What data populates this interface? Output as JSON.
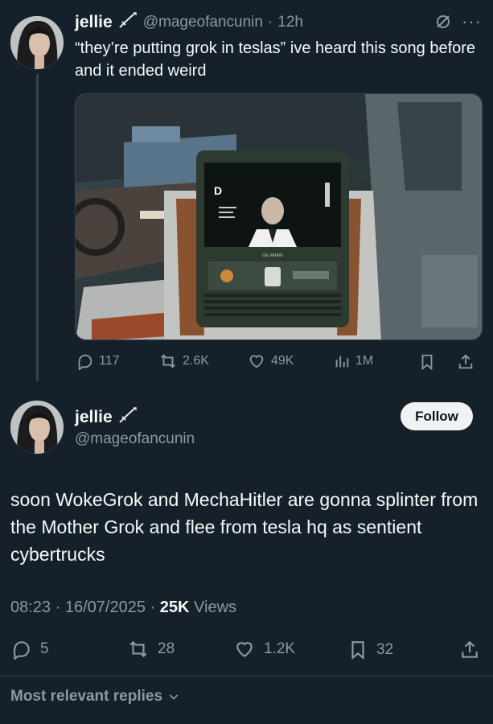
{
  "quoted_tweet": {
    "author_name": "jellie",
    "handle": "@mageofancunin",
    "separator": "·",
    "time": "12h",
    "text": "“they’re putting grok in teslas” ive heard this song before and it ended weird",
    "actions": {
      "replies": "117",
      "reposts": "2.6K",
      "likes": "49K",
      "views": "1M"
    }
  },
  "main_tweet": {
    "author_name": "jellie",
    "handle": "@mageofancunin",
    "follow_label": "Follow",
    "text": "soon WokeGrok and MechaHitler are gonna splinter from the Mother Grok and flee from tesla hq as sentient cybertrucks",
    "time": "08:23",
    "date": "16/07/2025",
    "dot": "·",
    "views_count": "25K",
    "views_label": "Views",
    "actions": {
      "replies": "5",
      "reposts": "28",
      "likes": "1.2K",
      "bookmarks": "32"
    }
  },
  "replies_sort_label": "Most relevant replies",
  "media": {
    "screen_label": "DELAMAIN"
  },
  "colors": {
    "background": "#15202b",
    "text": "#f7f9f9",
    "muted": "#8b98a5",
    "divider": "#38444d"
  }
}
